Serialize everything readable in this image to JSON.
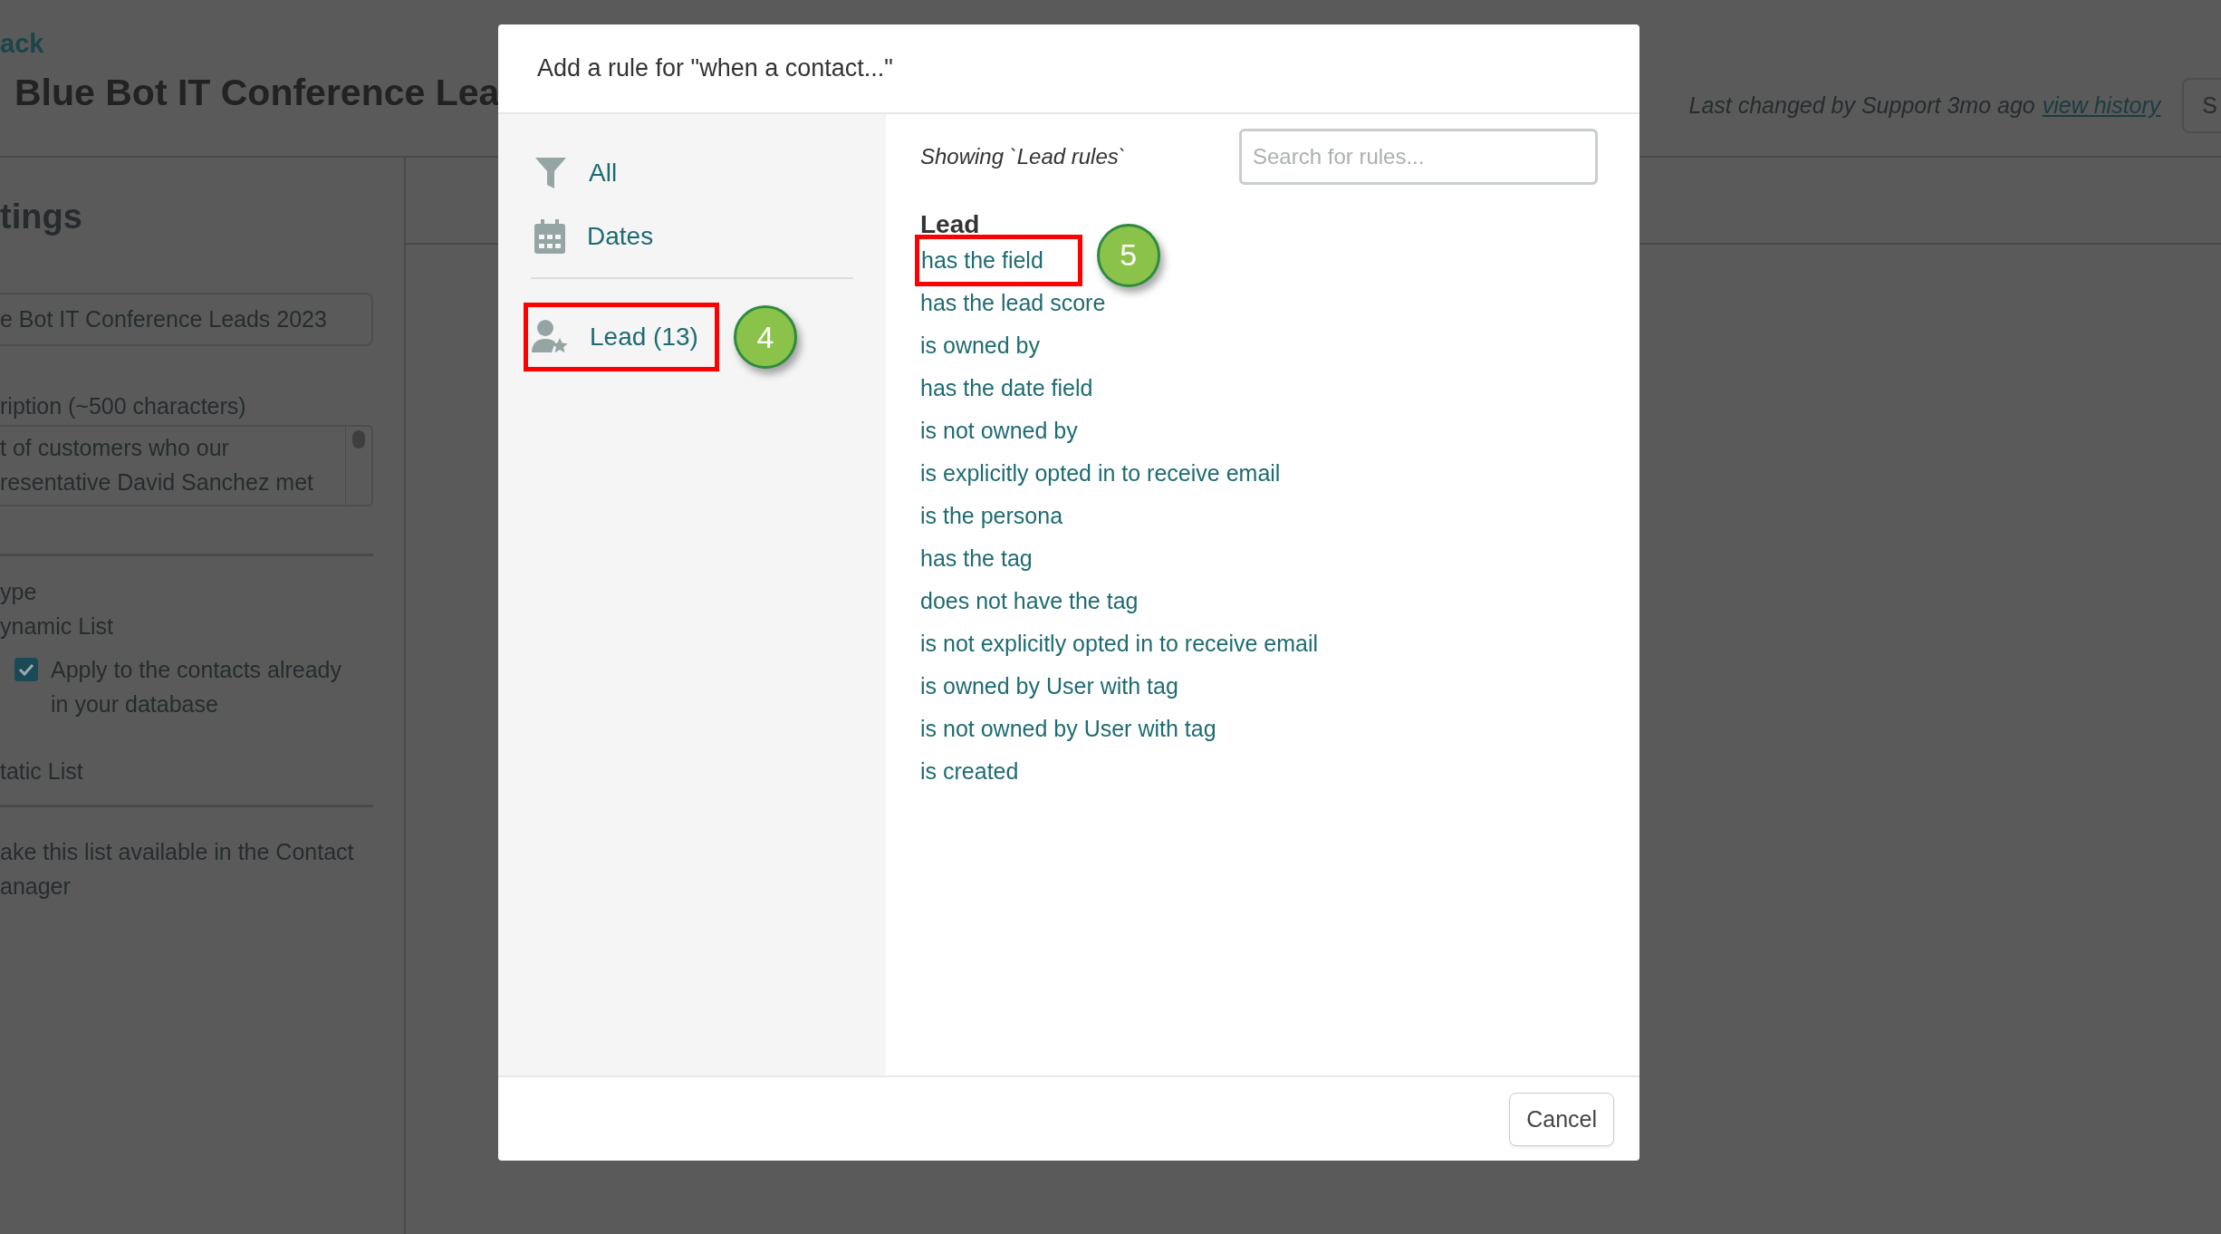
{
  "page": {
    "back_link": "ack",
    "title": "Blue Bot IT Conference Lea",
    "last_changed": "Last changed by Support 3mo ago",
    "history_link": "view history",
    "save_button": "S",
    "settings": {
      "heading": "tings",
      "name_value": "e Bot IT Conference Leads 2023",
      "description_label": "ription (~500 characters)",
      "description_lines": [
        "t of customers who our",
        "resentative David Sanchez met"
      ],
      "type_label": "ype",
      "dynamic_option": "ynamic List",
      "apply_checkbox": {
        "label": "Apply to the contacts already in your database",
        "checked": true
      },
      "static_option": "tatic List",
      "contact_manager_lines": [
        "ake this list available in the Contact",
        "anager"
      ]
    }
  },
  "modal": {
    "title": "Add a rule for \"when a contact...\"",
    "categories": [
      {
        "label": "All",
        "kind": "filter"
      },
      {
        "label": "Dates",
        "kind": "calendar"
      }
    ],
    "custom_categories": [
      {
        "label": "Lead (13)",
        "kind": "person",
        "callout": "4"
      }
    ],
    "showing": "Showing `Lead rules`",
    "search": {
      "placeholder": "Search for rules..."
    },
    "group_heading": "Lead",
    "rules": [
      {
        "label": "has the field",
        "callout": "5"
      },
      {
        "label": "has the lead score"
      },
      {
        "label": "is owned by"
      },
      {
        "label": "has the date field"
      },
      {
        "label": "is not owned by"
      },
      {
        "label": "is explicitly opted in to receive email"
      },
      {
        "label": "is the persona"
      },
      {
        "label": "has the tag"
      },
      {
        "label": "does not have the tag"
      },
      {
        "label": "is not explicitly opted in to receive email"
      },
      {
        "label": "is owned by User with tag"
      },
      {
        "label": "is not owned by User with tag"
      },
      {
        "label": "is created"
      }
    ],
    "cancel_button": "Cancel"
  }
}
